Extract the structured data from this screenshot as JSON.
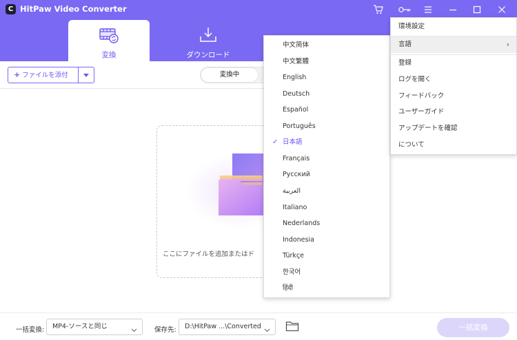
{
  "app": {
    "title": "HitPaw Video Converter",
    "logo_letter": "C",
    "brand_color": "#7a69f3",
    "accent_color": "#6b58f0"
  },
  "titlebar_icons": [
    "cart-icon",
    "key-icon",
    "menu-icon",
    "minimize-icon",
    "maximize-icon",
    "close-icon"
  ],
  "tabs": [
    {
      "label": "変換",
      "icon": "convert-film-icon",
      "active": true
    },
    {
      "label": "ダウンロード",
      "icon": "download-tray-icon",
      "active": false
    },
    {
      "label": "",
      "icon": "toolbox-icon",
      "active": false
    }
  ],
  "toolbar": {
    "add_file_label": "ファイルを添付",
    "add_file_plus": "+",
    "status_tabs": [
      "変換中"
    ]
  },
  "dropzone": {
    "text": "ここにファイルを追加またはド"
  },
  "bottom": {
    "batch_label": "一括変換:",
    "batch_value": "MP4-ソースと同じ",
    "save_label": "保存先:",
    "save_path": "D:\\HitPaw ...\\Converted",
    "convert_all_label": "一括変換",
    "convert_all_color": "#ddd6fb"
  },
  "language_menu": {
    "items": [
      "中文简体",
      "中文繁體",
      "English",
      "Deutsch",
      "Español",
      "Português",
      "日本語",
      "Français",
      "Русский",
      "العربية",
      "Italiano",
      "Nederlands",
      "Indonesia",
      "Türkçe",
      "한국어",
      "हिंदी"
    ],
    "selected": "日本語",
    "check": "✓"
  },
  "main_menu": {
    "items": [
      {
        "label": "環境設定"
      },
      {
        "label": "言語",
        "submenu_arrow": "›"
      },
      {
        "label": "登録"
      },
      {
        "label": "ログを開く"
      },
      {
        "label": "フィードバック"
      },
      {
        "label": "ユーザーガイド"
      },
      {
        "label": "アップデートを確認"
      },
      {
        "label": "について"
      }
    ]
  }
}
